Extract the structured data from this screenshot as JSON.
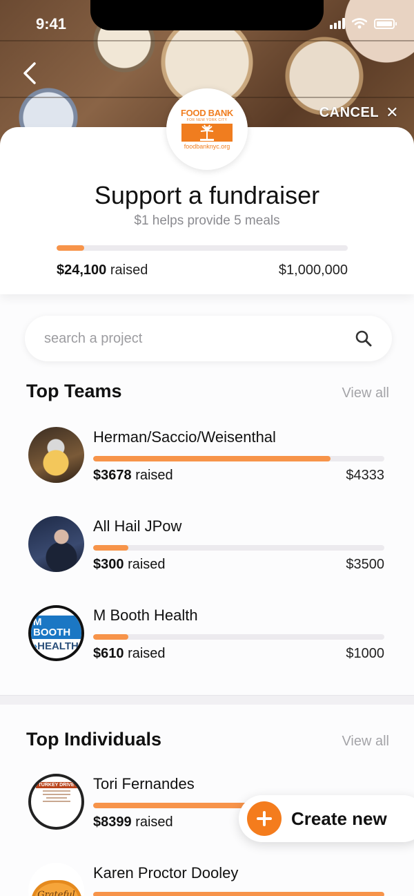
{
  "status_bar": {
    "time": "9:41"
  },
  "header": {
    "cancel_label": "CANCEL"
  },
  "logo": {
    "line1": "FOOD BANK",
    "line2": "FOR NEW YORK CITY",
    "url": "foodbanknyc.org"
  },
  "summary": {
    "title": "Support a fundraiser",
    "subtitle": "$1 helps provide 5 meals",
    "raised_amount": "$24,100",
    "raised_label": "raised",
    "goal": "$1,000,000",
    "progress": 0.094
  },
  "search": {
    "placeholder": "search a project"
  },
  "top_teams": {
    "title": "Top Teams",
    "view_all": "View all",
    "items": [
      {
        "name": "Herman/Saccio/Weisenthal",
        "raised": "$3678",
        "raised_label": "raised",
        "goal": "$4333",
        "progress": 0.816
      },
      {
        "name": "All Hail JPow",
        "raised": "$300",
        "raised_label": "raised",
        "goal": "$3500",
        "progress": 0.12
      },
      {
        "name": "M Booth Health",
        "raised": "$610",
        "raised_label": "raised",
        "goal": "$1000",
        "progress": 0.12,
        "logo_top": "M BOOTH",
        "logo_bottom": "HEALTH"
      }
    ]
  },
  "top_individuals": {
    "title": "Top Individuals",
    "view_all": "View all",
    "items": [
      {
        "name": "Tori Fernandes",
        "raised": "$8399",
        "raised_label": "raised",
        "progress": 0.55,
        "avatar_text": "TURKEY DRIVE"
      },
      {
        "name": "Karen Proctor Dooley",
        "progress": 1.0,
        "avatar_text": "Grateful Thankful"
      }
    ]
  },
  "fab": {
    "label": "Create new"
  },
  "colors": {
    "accent": "#f7944a",
    "fab_accent": "#f47c1d",
    "brand": "#f07d1f"
  }
}
